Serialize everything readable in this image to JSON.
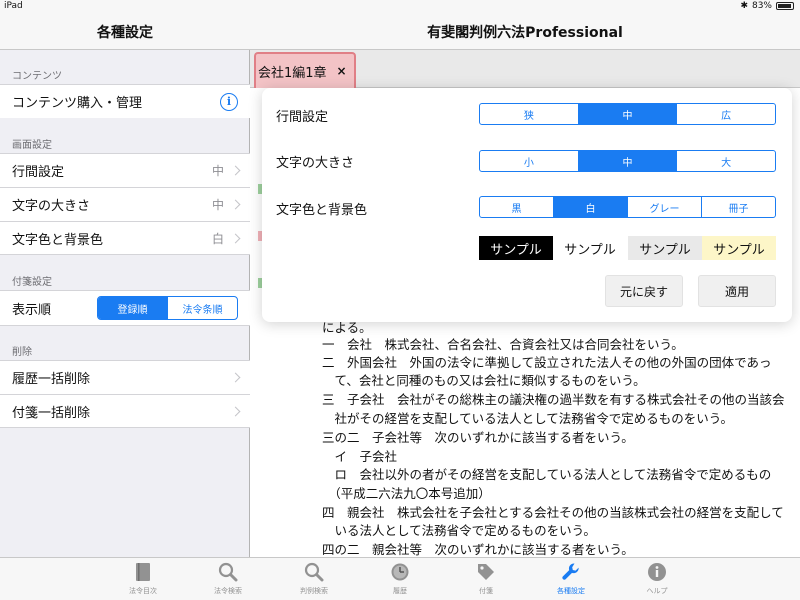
{
  "status_bar": {
    "device": "iPad",
    "battery": "83%"
  },
  "app_title": "有斐閣判例六法Professional",
  "sidebar": {
    "title": "各種設定",
    "sections": {
      "contents": {
        "header": "コンテンツ",
        "purchase_label": "コンテンツ購入・管理"
      },
      "screen": {
        "header": "画面設定",
        "rows": [
          {
            "label": "行間設定",
            "value": "中"
          },
          {
            "label": "文字の大きさ",
            "value": "中"
          },
          {
            "label": "文字色と背景色",
            "value": "白"
          }
        ]
      },
      "sticky": {
        "header": "付箋設定",
        "order_label": "表示順",
        "order_options": [
          "登録順",
          "法令条順"
        ]
      },
      "delete": {
        "header": "削除",
        "rows": [
          "履歴一括削除",
          "付箋一括削除"
        ]
      }
    }
  },
  "doc_tab": {
    "label": "会社1編1章",
    "close": "×"
  },
  "popover": {
    "line_spacing": {
      "label": "行間設定",
      "options": [
        "狭",
        "中",
        "広"
      ],
      "selected": "中"
    },
    "text_size": {
      "label": "文字の大きさ",
      "options": [
        "小",
        "中",
        "大"
      ],
      "selected": "中"
    },
    "color": {
      "label": "文字色と背景色",
      "options": [
        "黒",
        "白",
        "グレー",
        "冊子"
      ],
      "selected": "白"
    },
    "samples": [
      "サンプル",
      "サンプル",
      "サンプル",
      "サンプル"
    ],
    "reset_label": "元に戻す",
    "apply_label": "適用"
  },
  "document_lines": [
    "による。",
    "一　会社　株式会社、合名会社、合資会社又は合同会社をいう。",
    "二　外国会社　外国の法令に準拠して設立された法人その他の外国の団体であっ",
    "　て、会社と同種のもの又は会社に類似するものをいう。",
    "三　子会社　会社がその総株主の議決権の過半数を有する株式会社その他の当該会",
    "　社がその経営を支配している法人として法務省令で定めるものをいう。",
    "三の二　子会社等　次のいずれかに該当する者をいう。",
    "　イ　子会社",
    "　ロ　会社以外の者がその経営を支配している法人として法務省令で定めるもの",
    "　（平成二六法九〇本号追加）",
    "四　親会社　株式会社を子会社とする会社その他の当該株式会社の経営を支配して",
    "　いる法人として法務省令で定めるものをいう。",
    "四の二　親会社等　次のいずれかに該当する者をいう。"
  ],
  "tabbar": {
    "items": [
      {
        "label": "法令目次",
        "icon": "book-icon"
      },
      {
        "label": "法令検索",
        "icon": "search-icon"
      },
      {
        "label": "判例検索",
        "icon": "search-icon"
      },
      {
        "label": "履歴",
        "icon": "clock-icon"
      },
      {
        "label": "付箋",
        "icon": "tag-icon"
      },
      {
        "label": "各種設定",
        "icon": "wrench-icon",
        "active": true
      },
      {
        "label": "ヘルプ",
        "icon": "info-icon"
      }
    ]
  },
  "colors": {
    "accent": "#1a7cf2",
    "tab_fill": "#f3c3c6",
    "tab_border": "#e07f86",
    "sample_gray": "#e9e9e9",
    "sample_cream": "#fdf6c8"
  }
}
